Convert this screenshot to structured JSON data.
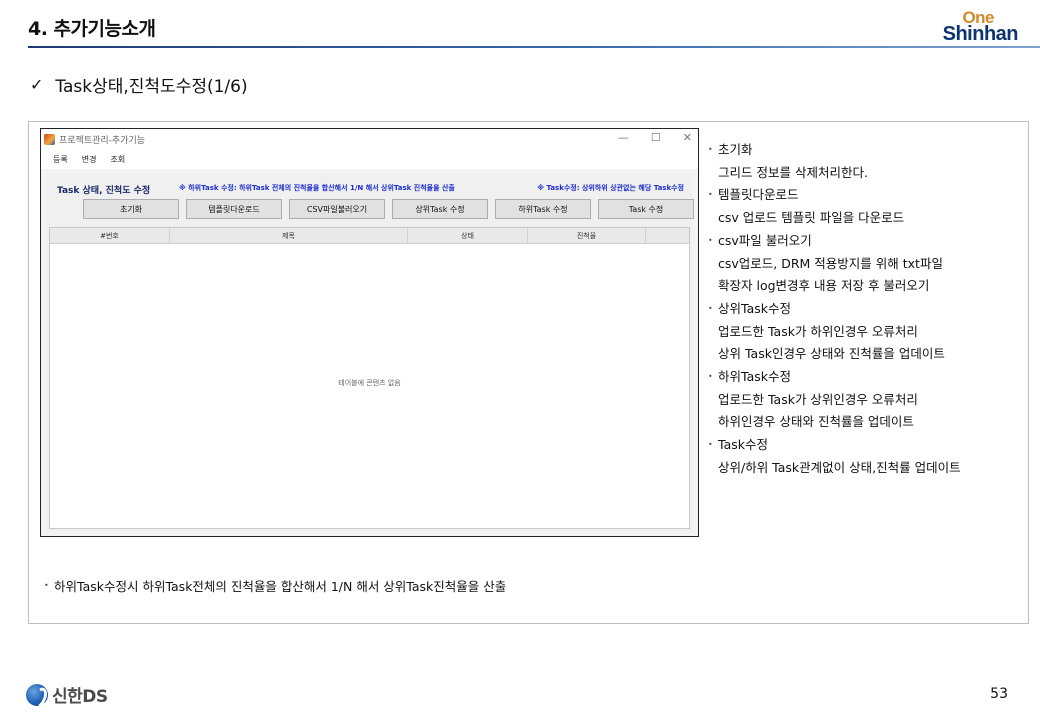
{
  "header": {
    "title": "4. 추가기능소개",
    "logo_one": "One",
    "logo_shinhan": "Shinhan"
  },
  "subtitle": {
    "check_icon": "✓",
    "text": "Task상태,진척도수정(1/6)"
  },
  "app": {
    "window_title": "프로젝트관리-추가기능",
    "controls": {
      "minimize": "—",
      "maximize": "☐",
      "close": "✕"
    },
    "menu": [
      "등록",
      "변경",
      "조회"
    ],
    "panel_title": "Task 상태, 진척도 수정",
    "note_left": "※ 하위Task 수정: 하위Task 전체의 진척율을 합산해서 1/N 해서 상위Task 진척율을 산출",
    "note_right": "※ Task수정: 상위하위 상관없는 해당 Task수정",
    "buttons": [
      "초기화",
      "템플릿다운로드",
      "CSV파일불러오기",
      "상위Task 수정",
      "하위Task 수정",
      "Task 수정"
    ],
    "grid_columns": [
      "#번호",
      "제목",
      "상태",
      "진척율"
    ],
    "grid_empty": "테이블에 콘텐츠 없음"
  },
  "description": {
    "bullet": "•",
    "items": [
      {
        "title": "초기화",
        "lines": [
          "그리드 정보를 삭제처리한다."
        ]
      },
      {
        "title": "템플릿다운로드",
        "lines": [
          "csv 업로드 템플릿 파일을 다운로드"
        ]
      },
      {
        "title": "csv파일 불러오기",
        "lines": [
          "csv업로드, DRM 적용방지를 위해 txt파일",
          "확장자 log변경후 내용 저장 후 불러오기"
        ]
      },
      {
        "title": "상위Task수정",
        "lines": [
          "업로드한 Task가 하위인경우 오류처리",
          "상위 Task인경우 상태와 진척률을 업데이트"
        ]
      },
      {
        "title": "하위Task수정",
        "lines": [
          "업로드한 Task가 상위인경우 오류처리",
          "하위인경우 상태와 진척률을 업데이트"
        ]
      },
      {
        "title": "Task수정",
        "lines": [
          "상위/하위 Task관계없이 상태,진척률 업데이트"
        ]
      }
    ]
  },
  "bottom_note": "하위Task수정시 하위Task전체의 진척율을 합산해서 1/N 해서 상위Task진척율을 산출",
  "footer": {
    "company": "신한DS",
    "page_number": "53"
  },
  "colors": {
    "brand_navy": "#0c3470",
    "brand_orange": "#d48a2a",
    "note_blue": "#1e2fd0"
  }
}
